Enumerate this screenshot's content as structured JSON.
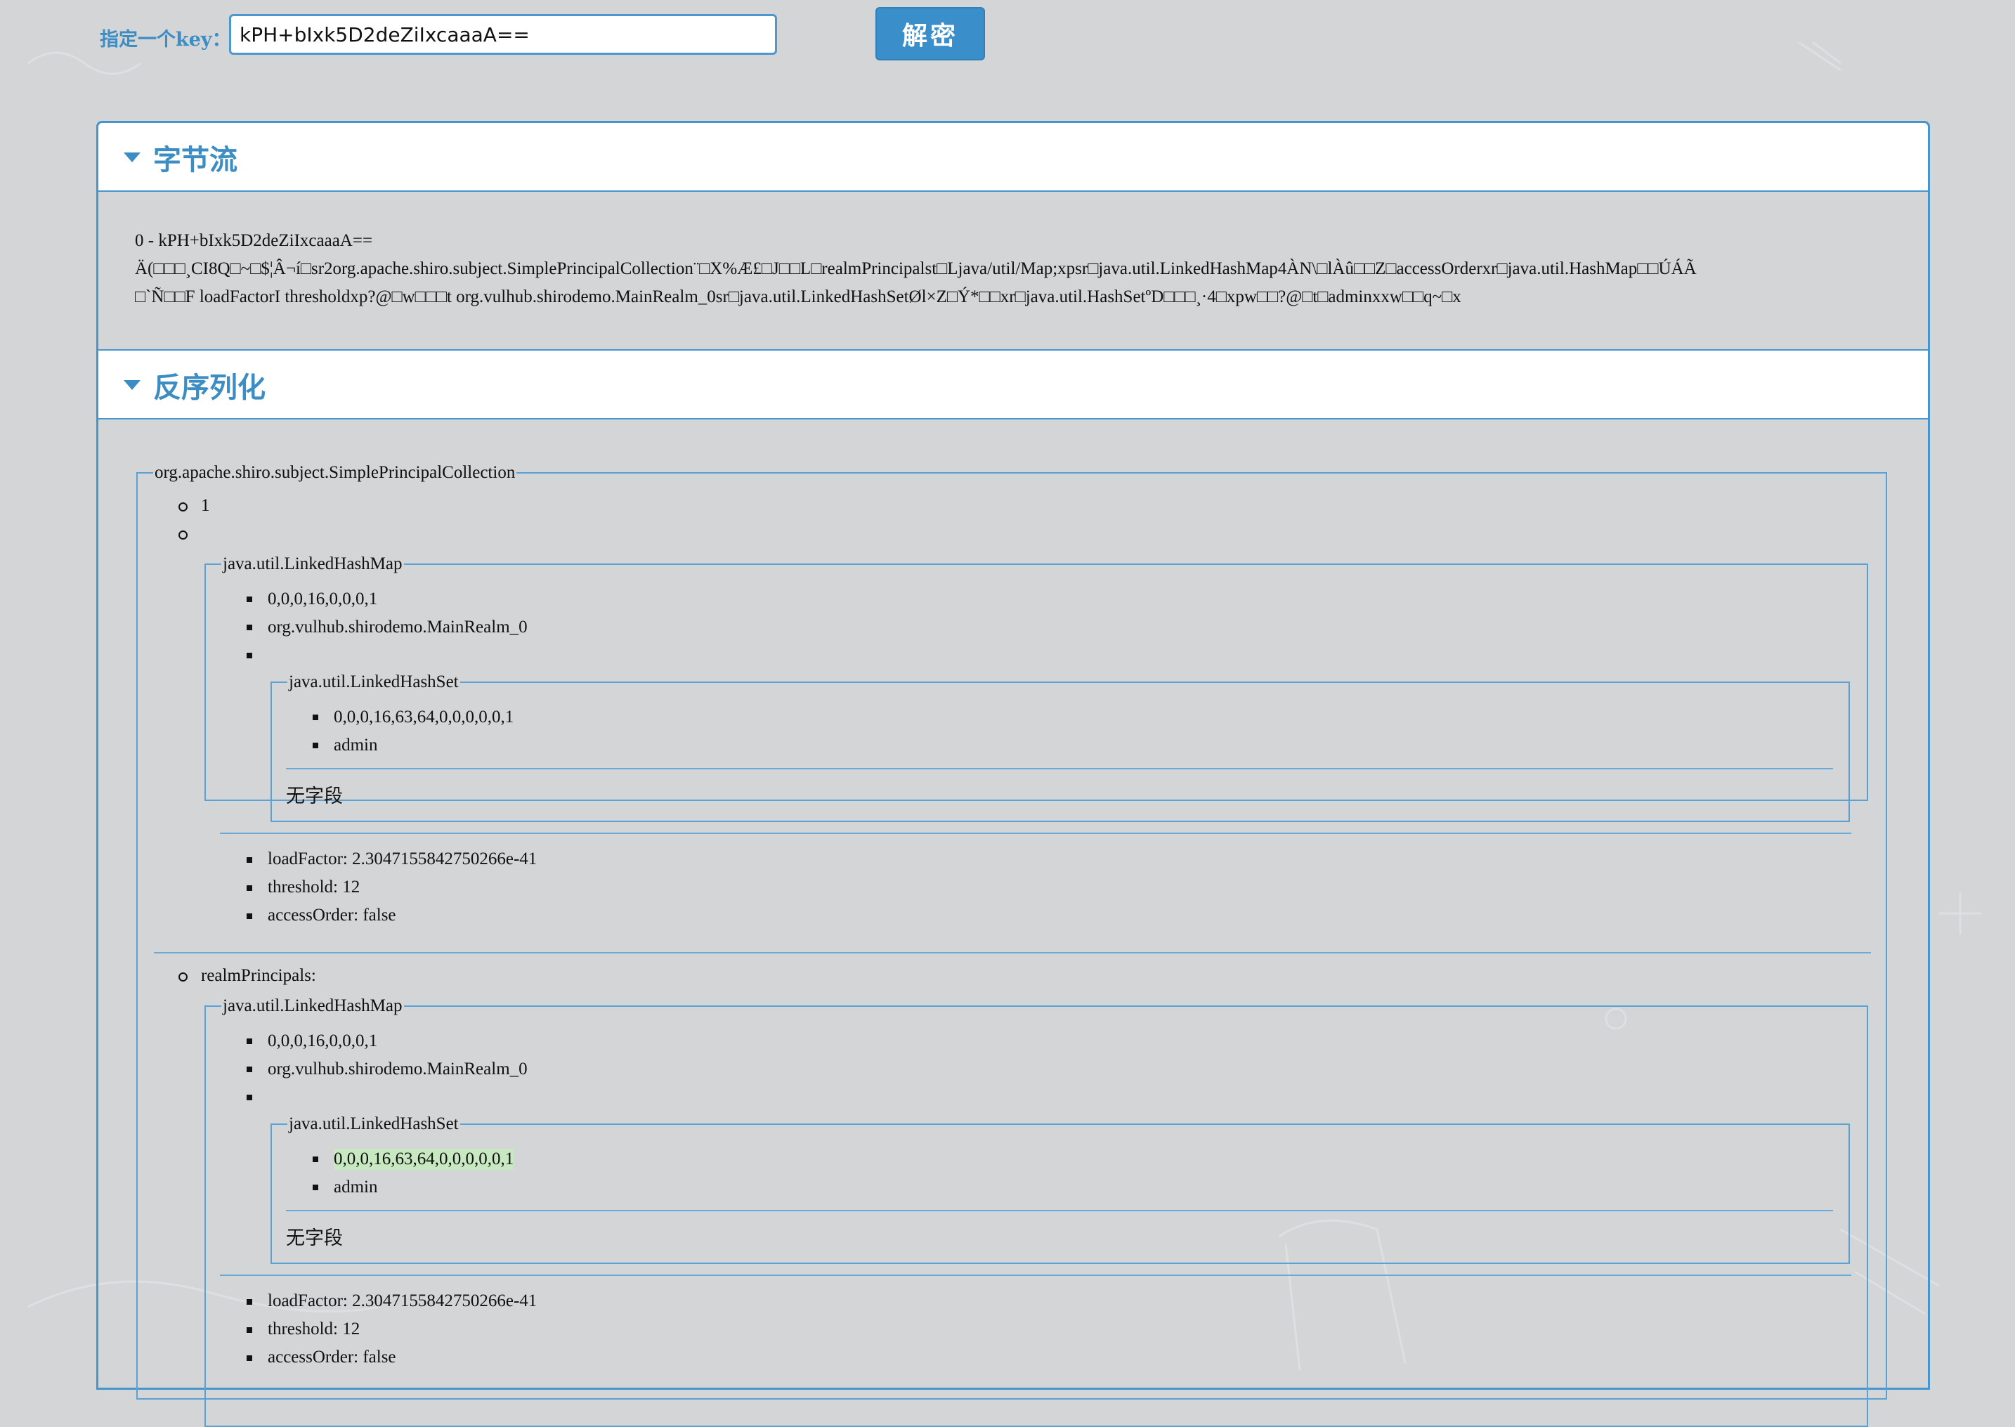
{
  "key_label": "指定一个key：",
  "key_value": "kPH+bIxk5D2deZiIxcaaaA==",
  "decrypt_label": "解密",
  "sections": {
    "bytes_title": "字节流",
    "deser_title": "反序列化"
  },
  "bytes_lines": [
    "0 - kPH+bIxk5D2deZiIxcaaaA==",
    "Ä(□□□¸CI8Q□~□$¦Â¬í□sr2org.apache.shiro.subject.SimplePrincipalCollection¨□X%Æ£□J□□L□realmPrincipalst□Ljava/util/Map;xpsr□java.util.LinkedHashMap4ÀN\\□lÀû□□Z□accessOrderxr□java.util.HashMap□□ÚÁÃ",
    "□`Ñ□□F loadFactorI thresholdxp?@□w□□□t org.vulhub.shirodemo.MainRealm_0sr□java.util.LinkedHashSetØl×Z□Ý*□□xr□java.util.HashSetºD□□□¸·4□xpw□□?@□t□adminxxw□□q~□x"
  ],
  "tree": {
    "root_class": "org.apache.shiro.subject.SimplePrincipalCollection",
    "item_one": "1",
    "map_class": "java.util.LinkedHashMap",
    "map_header": "0,0,0,16,0,0,0,1",
    "realm_name": "org.vulhub.shirodemo.MainRealm_0",
    "set_class": "java.util.LinkedHashSet",
    "set_header": "0,0,0,16,63,64,0,0,0,0,0,1",
    "set_value": "admin",
    "no_fields": "无字段",
    "load_factor": "loadFactor: 2.3047155842750266e-41",
    "threshold": "threshold: 12",
    "access_order": "accessOrder: false",
    "realm_principals": "realmPrincipals:"
  }
}
